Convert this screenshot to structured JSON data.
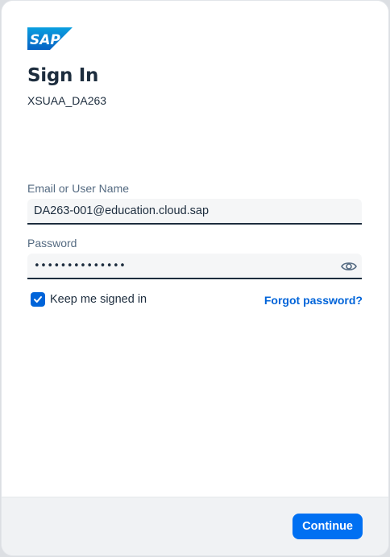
{
  "brand": {
    "logo_text": "SAP",
    "logo_color": "#0a6ed1"
  },
  "header": {
    "title": "Sign In",
    "tenant": "XSUAA_DA263"
  },
  "form": {
    "email_label": "Email or User Name",
    "email_value": "DA263-001@education.cloud.sap",
    "password_label": "Password",
    "password_value": "••••••••••••••",
    "reveal_icon": "eye-icon",
    "keep_signed_in_label": "Keep me signed in",
    "keep_signed_in_checked": true,
    "forgot_password_link": "Forgot password?"
  },
  "footer": {
    "continue_label": "Continue"
  },
  "colors": {
    "accent": "#0070f2",
    "link": "#0064d9",
    "text": "#1d2d3e",
    "label": "#556b82"
  }
}
